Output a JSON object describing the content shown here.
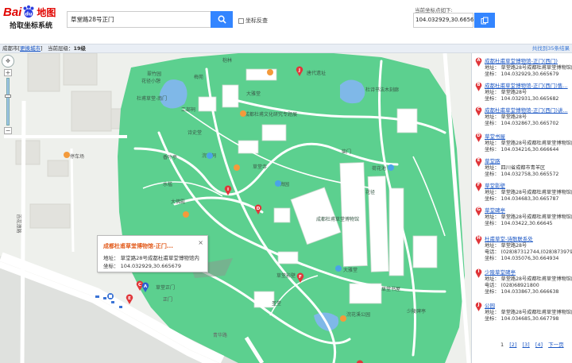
{
  "brand": {
    "logo_text": "Bai",
    "logo_du": "du",
    "logo_map": "地图",
    "subtitle": "拾取坐标系统"
  },
  "search": {
    "value": "草堂路28号正门",
    "button_icon": "search-icon"
  },
  "coord_reverse": {
    "label": "坐标反查",
    "checked": false
  },
  "current_coord": {
    "label": "当前坐标点如下:",
    "value": "104.032929,30.665679",
    "copy_label": "复制"
  },
  "infobar": {
    "city": "成都市",
    "switch_label": "更换城市",
    "zoom_label": "当前层级：",
    "zoom_value": "19级",
    "found": "共找到35条结果"
  },
  "popup": {
    "title": "成都杜甫草堂博物馆-正门...",
    "address": "地址：  草堂路28号成都杜甫草堂博物馆内",
    "coord": "坐标：  104.032929,30.665679",
    "close": "×"
  },
  "map_labels": {
    "cuizhuyuan": "翠竹园",
    "lunlin": "桤林",
    "huajingxiao": "花径小憩",
    "zhimu": "梅苑",
    "dishuo": "杜甫草堂-南门",
    "gongbu": "工部祠",
    "caotang_exhibit": "成都杜甫文化研究专题展",
    "tangduo": "唐代遗址",
    "dashiqiao": "大雅堂",
    "hantangge": "杜诗书法木刻廊",
    "shixian": "诗史堂",
    "xiangye": "香叶亭",
    "huanyuange": "浣花祠",
    "caotangsi": "草堂寺",
    "chaiyue": "柴门",
    "ronghutang": "荷花池",
    "shuijian": "水槛",
    "meiyuan": "梅园",
    "dafojing": "大佛殿",
    "caotangtang": "成都杜甫草堂博物馆",
    "dadian": "大雅堂",
    "huajing": "花径",
    "caotang_south": "草堂影壁",
    "wanhuaxi": "浣花溪公园",
    "qinghuaroad": "青华路",
    "road_chengdu": "百花潭路",
    "gate_label": "正门",
    "shengtang": "圣堂",
    "caotang_lib": "草堂书屋",
    "hall2": "少陵碑亭",
    "zhengmen": "草堂正门",
    "parking": "停车场"
  },
  "results": [
    {
      "letter": "A",
      "name": "成都杜甫草堂博物馆-正门(西门)",
      "address": "地址：  草堂路28号成都杜甫草堂博物馆内",
      "coord": "坐标：  104.032929,30.665679"
    },
    {
      "letter": "B",
      "name": "成都杜甫草堂博物馆-正门(西门)售...",
      "address": "地址：  草堂路28号",
      "coord": "坐标：  104.032931,30.665682"
    },
    {
      "letter": "C",
      "name": "成都杜甫草堂博物馆-正门(西门)讲...",
      "address": "地址：  草堂路28号",
      "coord": "坐标：  104.032867,30.665702"
    },
    {
      "letter": "D",
      "name": "草堂书屋",
      "address": "地址：  草堂路28号成都杜甫草堂博物馆内",
      "coord": "坐标：  104.034216,30.666644"
    },
    {
      "letter": "E",
      "name": "草堂路",
      "address": "地址：  四川省成都市青羊区",
      "coord": "坐标：  104.032758,30.665572"
    },
    {
      "letter": "F",
      "name": "草堂影壁",
      "address": "地址：  草堂路28号成都杜甫草堂博物馆内",
      "coord": "坐标：  104.034683,30.665787"
    },
    {
      "letter": "G",
      "name": "草堂碑亭",
      "address": "地址：  草堂路28号成都杜甫草堂博物馆内",
      "coord": "坐标：  104.03422,30.66645"
    },
    {
      "letter": "H",
      "name": "杜甫草堂-诗歌联系处",
      "address": "地址：  草堂路28号",
      "phone": "电话：  (028)87312744,(028)87397908",
      "coord": "坐标：  104.035076,30.664934"
    },
    {
      "letter": "I",
      "name": "少陵草堂碑亭",
      "address": "地址：  草堂路28号成都杜甫草堂博物馆内",
      "phone": "电话：  (028)68921800",
      "coord": "坐标：  104.033867,30.666638"
    },
    {
      "letter": "J",
      "name": "公园",
      "address": "地址：  草堂路28号成都杜甫草堂博物馆内",
      "coord": "坐标：  104.034685,30.667798"
    }
  ],
  "pager": {
    "pages": [
      "1",
      "[2]",
      "[3]",
      "[4]"
    ],
    "next": "下一页"
  },
  "colors": {
    "park_green": "#5cd08f",
    "accent_blue": "#3385ff",
    "pin_red": "#e0363a",
    "link_blue": "#1a56c4"
  }
}
